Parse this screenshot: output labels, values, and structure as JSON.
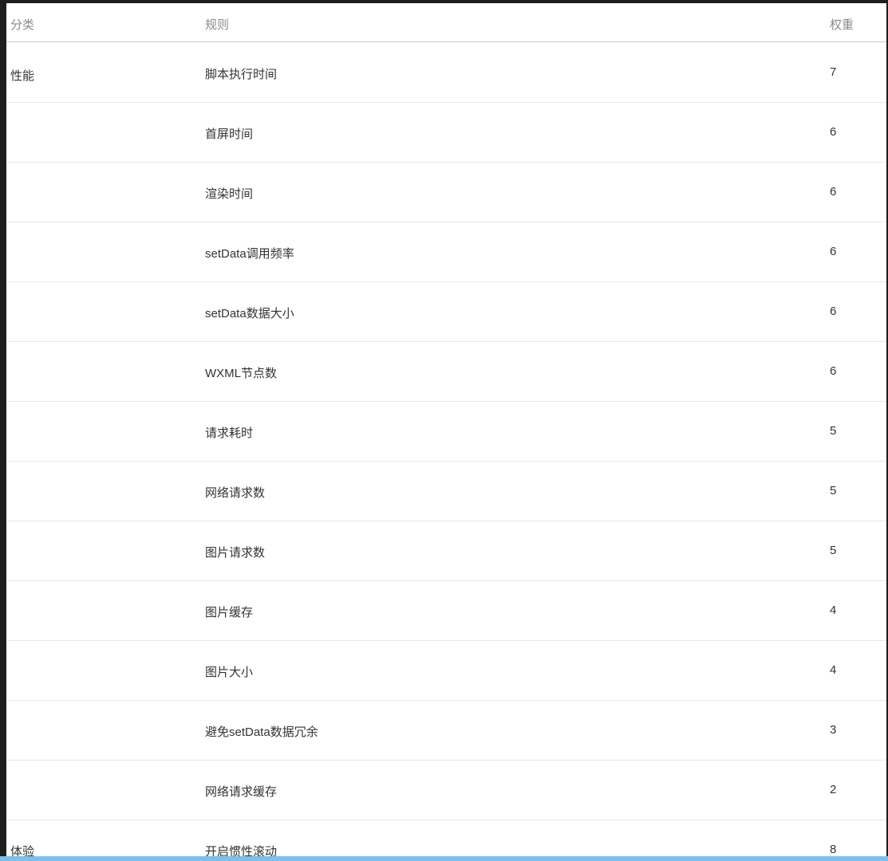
{
  "table": {
    "headers": {
      "category": "分类",
      "rule": "规则",
      "weight": "权重"
    },
    "rows": [
      {
        "category": "性能",
        "rule": "脚本执行时间",
        "weight": "7"
      },
      {
        "category": "",
        "rule": "首屏时间",
        "weight": "6"
      },
      {
        "category": "",
        "rule": "渲染时间",
        "weight": "6"
      },
      {
        "category": "",
        "rule": "setData调用频率",
        "weight": "6"
      },
      {
        "category": "",
        "rule": "setData数据大小",
        "weight": "6"
      },
      {
        "category": "",
        "rule": "WXML节点数",
        "weight": "6"
      },
      {
        "category": "",
        "rule": "请求耗时",
        "weight": "5"
      },
      {
        "category": "",
        "rule": "网络请求数",
        "weight": "5"
      },
      {
        "category": "",
        "rule": "图片请求数",
        "weight": "5"
      },
      {
        "category": "",
        "rule": "图片缓存",
        "weight": "4"
      },
      {
        "category": "",
        "rule": "图片大小",
        "weight": "4"
      },
      {
        "category": "",
        "rule": "避免setData数据冗余",
        "weight": "3"
      },
      {
        "category": "",
        "rule": "网络请求缓存",
        "weight": "2"
      },
      {
        "category": "体验",
        "rule": "开启惯性滚动",
        "weight": "8"
      }
    ]
  },
  "colors": {
    "header_text": "#8a8a8a",
    "cell_text": "#333333",
    "row_divider": "#e8e8e8",
    "header_divider": "#c9c9c9",
    "bottom_bar": "#7ec0e8"
  }
}
